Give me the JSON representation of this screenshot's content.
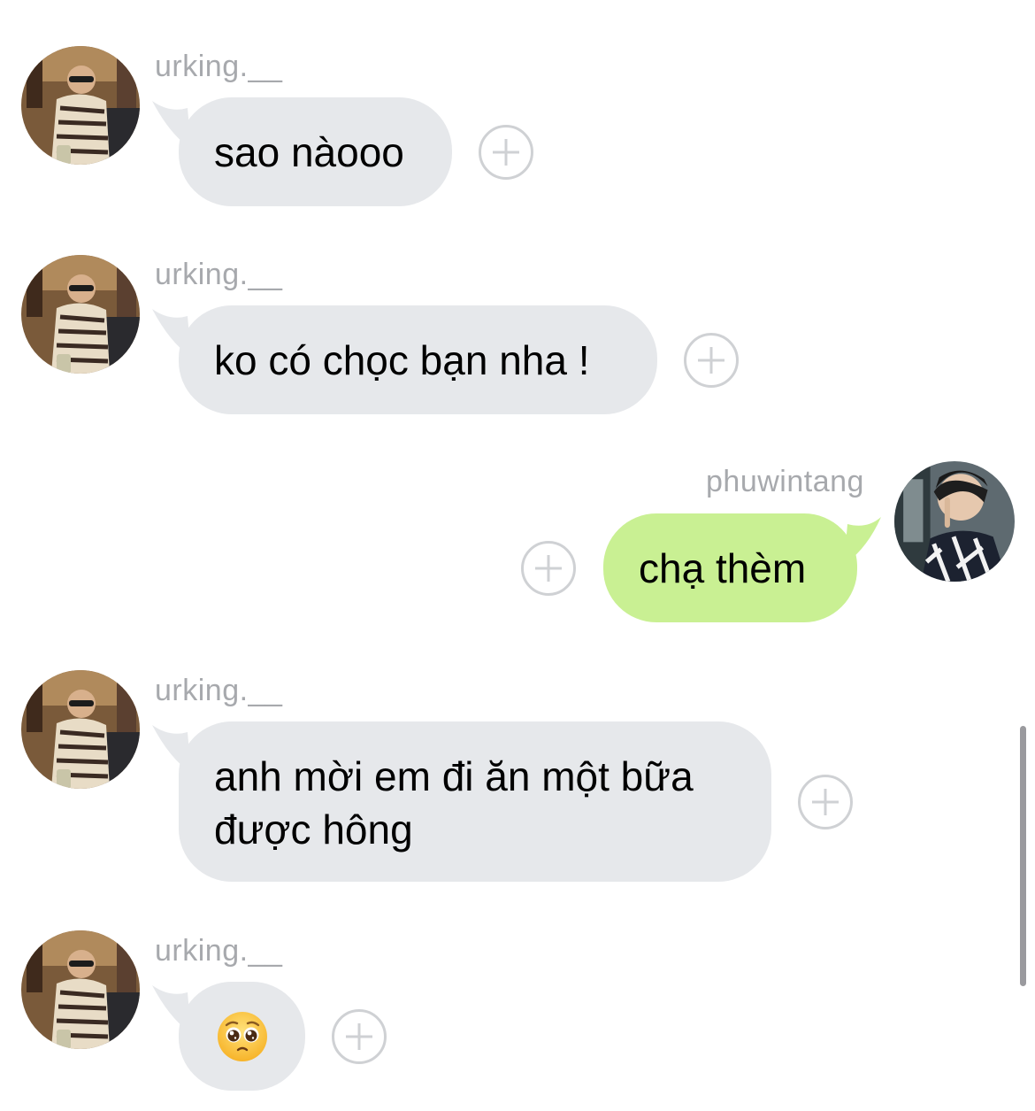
{
  "colors": {
    "incoming_bubble": "#e6e8eb",
    "outgoing_bubble": "#c9f093",
    "sender_name": "#a7a9ad",
    "add_button": "#cfd1d4"
  },
  "messages": [
    {
      "sender": "urking.__",
      "direction": "incoming",
      "text": "sao nàooo",
      "add_reaction_icon": "plus-circle-icon"
    },
    {
      "sender": "urking.__",
      "direction": "incoming",
      "text": "ko có chọc bạn nha !",
      "add_reaction_icon": "plus-circle-icon"
    },
    {
      "sender": "phuwintang",
      "direction": "outgoing",
      "text": "chạ thèm",
      "add_reaction_icon": "plus-circle-icon"
    },
    {
      "sender": "urking.__",
      "direction": "incoming",
      "text": "anh mời em đi ăn một bữa\nđược hông",
      "add_reaction_icon": "plus-circle-icon"
    },
    {
      "sender": "urking.__",
      "direction": "incoming",
      "emoji": "pleading-face-emoji",
      "add_reaction_icon": "plus-circle-icon"
    }
  ]
}
